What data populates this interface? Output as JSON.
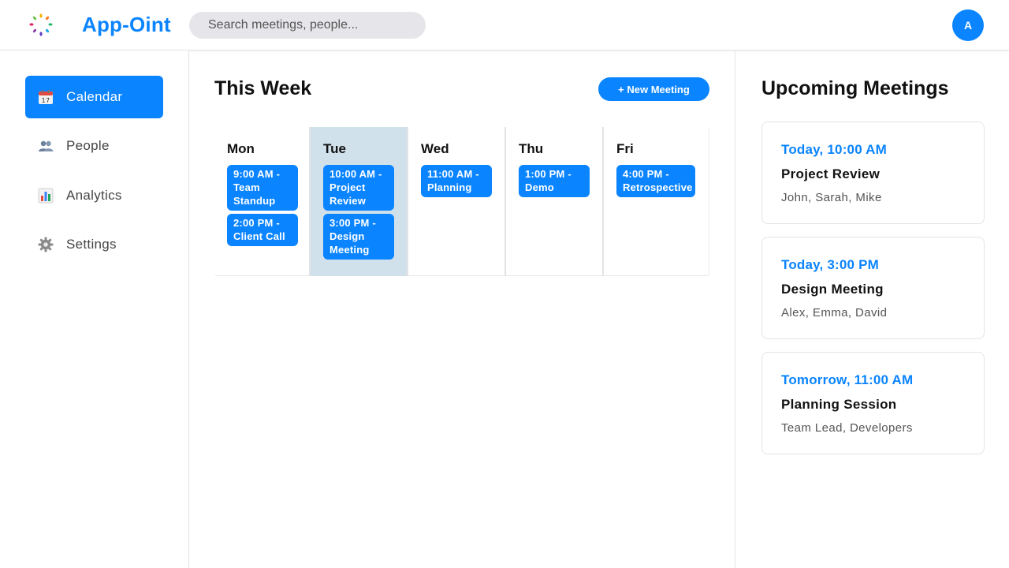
{
  "header": {
    "brand": "App-Oint",
    "search_placeholder": "Search meetings, people...",
    "avatar_initial": "A"
  },
  "sidebar": {
    "items": [
      {
        "label": "Calendar",
        "icon": "calendar-icon",
        "active": true
      },
      {
        "label": "People",
        "icon": "people-icon",
        "active": false
      },
      {
        "label": "Analytics",
        "icon": "bar-chart-icon",
        "active": false
      },
      {
        "label": "Settings",
        "icon": "gear-icon",
        "active": false
      }
    ]
  },
  "main": {
    "title": "This Week",
    "new_meeting_label": "+ New Meeting",
    "days": [
      {
        "name": "Mon",
        "events": [
          "9:00 AM - Team Standup",
          "2:00 PM - Client Call"
        ]
      },
      {
        "name": "Tue",
        "highlighted": true,
        "events": [
          "10:00 AM - Project Review",
          "3:00 PM - Design Meeting"
        ]
      },
      {
        "name": "Wed",
        "events": [
          "11:00 AM - Planning"
        ]
      },
      {
        "name": "Thu",
        "events": [
          "1:00 PM - Demo"
        ]
      },
      {
        "name": "Fri",
        "events": [
          "4:00 PM - Retrospective"
        ]
      }
    ]
  },
  "upcoming": {
    "title": "Upcoming Meetings",
    "meetings": [
      {
        "time": "Today, 10:00 AM",
        "title": "Project Review",
        "people": "John, Sarah, Mike"
      },
      {
        "time": "Today, 3:00 PM",
        "title": "Design Meeting",
        "people": "Alex, Emma, David"
      },
      {
        "time": "Tomorrow, 11:00 AM",
        "title": "Planning Session",
        "people": "Team Lead, Developers"
      }
    ]
  },
  "colors": {
    "accent": "#0a84ff",
    "today_column": "#d1e1ec"
  }
}
